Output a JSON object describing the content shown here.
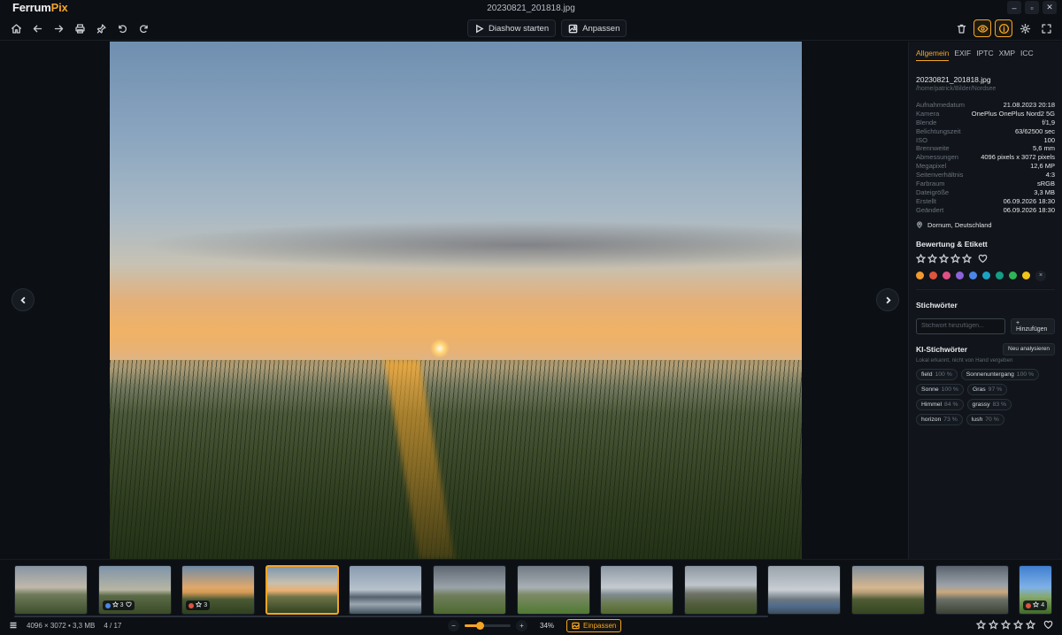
{
  "app": {
    "name_part1": "Ferrum",
    "name_part2": "Pix",
    "window_title": "20230821_201818.jpg"
  },
  "window_buttons": [
    "–",
    "▫",
    "✕"
  ],
  "toolbar": {
    "left_icons": [
      "home-icon",
      "arrow-left-icon",
      "arrow-right-icon",
      "print-icon",
      "pin-icon",
      "rotate-left-icon",
      "rotate-right-icon"
    ],
    "slideshow_label": "Diashow starten",
    "adjust_label": "Anpassen",
    "right_icons": [
      "trash-icon",
      "eye-icon",
      "info-icon",
      "gear-icon",
      "fullscreen-icon"
    ]
  },
  "sidebar": {
    "tabs": [
      {
        "label": "Allgemein",
        "active": true
      },
      {
        "label": "EXIF",
        "active": false
      },
      {
        "label": "IPTC",
        "active": false
      },
      {
        "label": "XMP",
        "active": false
      },
      {
        "label": "ICC",
        "active": false
      }
    ],
    "file_name": "20230821_201818.jpg",
    "file_path": "/home/patrick/Bilder/Nordsee",
    "metadata": [
      {
        "key": "Aufnahmedatum",
        "value": "21.08.2023 20:18"
      },
      {
        "key": "Kamera",
        "value": "OnePlus OnePlus Nord2 5G"
      },
      {
        "key": "Blende",
        "value": "f/1,9"
      },
      {
        "key": "Belichtungszeit",
        "value": "63/62500 sec"
      },
      {
        "key": "ISO",
        "value": "100"
      },
      {
        "key": "Brennweite",
        "value": "5,6 mm"
      },
      {
        "key": "Abmessungen",
        "value": "4096 pixels x 3072 pixels"
      },
      {
        "key": "Megapixel",
        "value": "12,6 MP"
      },
      {
        "key": "Seitenverhältnis",
        "value": "4:3"
      },
      {
        "key": "Farbraum",
        "value": "sRGB"
      },
      {
        "key": "Dateigröße",
        "value": "3,3 MB"
      },
      {
        "key": "Erstellt",
        "value": "06.09.2026 18:30"
      },
      {
        "key": "Geändert",
        "value": "06.09.2026 18:30"
      }
    ],
    "location": "Dornum, Deutschland",
    "rating_title": "Bewertung & Etikett",
    "rating_stars": 0,
    "label_colors": [
      "#f29a2e",
      "#e0533d",
      "#e04f86",
      "#8e62d9",
      "#4a86e8",
      "#1ca2c4",
      "#149d86",
      "#2fb457",
      "#f0c419"
    ],
    "clear_label": "×",
    "keywords_title": "Stichwörter",
    "keyword_placeholder": "Stichwort hinzufügen...",
    "add_label": "+ Hinzufügen",
    "ai_title": "KI-Stichwörter",
    "reanalyse_label": "Neu analysieren",
    "ai_subtitle": "Lokal erkannt, nicht von Hand vergeben",
    "ai_keywords": [
      {
        "word": "field",
        "pct": "100 %"
      },
      {
        "word": "Sonnenuntergang",
        "pct": "100 %"
      },
      {
        "word": "Sonne",
        "pct": "100 %"
      },
      {
        "word": "Gras",
        "pct": "97 %"
      },
      {
        "word": "Himmel",
        "pct": "84 %"
      },
      {
        "word": "grassy",
        "pct": "83 %"
      },
      {
        "word": "horizon",
        "pct": "73 %"
      },
      {
        "word": "lush",
        "pct": "70 %"
      }
    ]
  },
  "filmstrip": {
    "thumbnails": [
      {
        "bg": "linear-gradient(180deg,#8795a3 0%,#c0b9aa 45%,#6f7a5a 60%,#3d4e2b 100%)",
        "badge": null
      },
      {
        "bg": "linear-gradient(180deg,#7e93a9 0%,#b8b6a3 50%,#5c6b47 62%,#3a4b27 100%)",
        "badge": {
          "dot": "#4a86e8",
          "stars": "3",
          "heart": true
        }
      },
      {
        "bg": "linear-gradient(180deg,#6f8aa6 0%,#e0a86a 45%,#d49a55 55%,#4a5934 70%,#2f401f 100%)",
        "badge": {
          "dot": "#e0533d",
          "stars": "3",
          "heart": false
        }
      },
      {
        "bg": "linear-gradient(180deg,#7e97b0 0%,#c7bfae 35%,#eab06f 52%,#6e7348 65%,#32431f 100%)",
        "badge": null
      },
      {
        "bg": "linear-gradient(180deg,#8a9bb0 0%,#b7c2cc 50%,#54626e 65%,#9aa7b0 80%,#40505e 100%)",
        "badge": null
      },
      {
        "bg": "linear-gradient(180deg,#5f6872 0%,#9aa3aa 45%,#6f7d5a 62%,#4c6a30 100%)",
        "badge": null
      },
      {
        "bg": "linear-gradient(180deg,#717a84 0%,#a9b0b5 45%,#7d8a66 60%,#4f7a33 100%)",
        "badge": null
      },
      {
        "bg": "linear-gradient(180deg,#8d98a4 0%,#c5cbd0 45%,#7f8a8e 60%,#6a7b4c 80%,#51672f 100%)",
        "badge": null
      },
      {
        "bg": "linear-gradient(180deg,#8c96a0 0%,#c0c6cb 40%,#6f7468 58%,#515c3c 80%,#3e5527 100%)",
        "badge": null
      },
      {
        "bg": "linear-gradient(180deg,#9aa3ac 0%,#c8ced3 50%,#6d7780 70%,#4d6a8c 85%,#3f4d58 100%)",
        "badge": null
      },
      {
        "bg": "linear-gradient(180deg,#7f8d9c 0%,#d6b790 45%,#b8a07a 55%,#4e5b35 70%,#35461f 100%)",
        "badge": null
      },
      {
        "bg": "linear-gradient(180deg,#5a636e 0%,#9aa1a8 40%,#c9a77c 55%,#6a6f66 70%,#3c4136 100%)",
        "badge": null
      },
      {
        "bg": "linear-gradient(180deg,#3f7fd0 0%,#7fb1e6 45%,#86a86a 65%,#3f6a27 100%)",
        "badge": {
          "dot": "#e0533d",
          "stars": "4",
          "heart": false
        }
      }
    ],
    "selected_index": 3
  },
  "statusbar": {
    "dimensions": "4096 × 3072",
    "separator": "•",
    "size": "3,3 MB",
    "position": "4 / 17",
    "zoom_minus": "−",
    "zoom_plus": "+",
    "zoom_level": 0.34,
    "zoom_text": "34%",
    "fit_label": "Einpassen",
    "rating_stars": 0
  }
}
